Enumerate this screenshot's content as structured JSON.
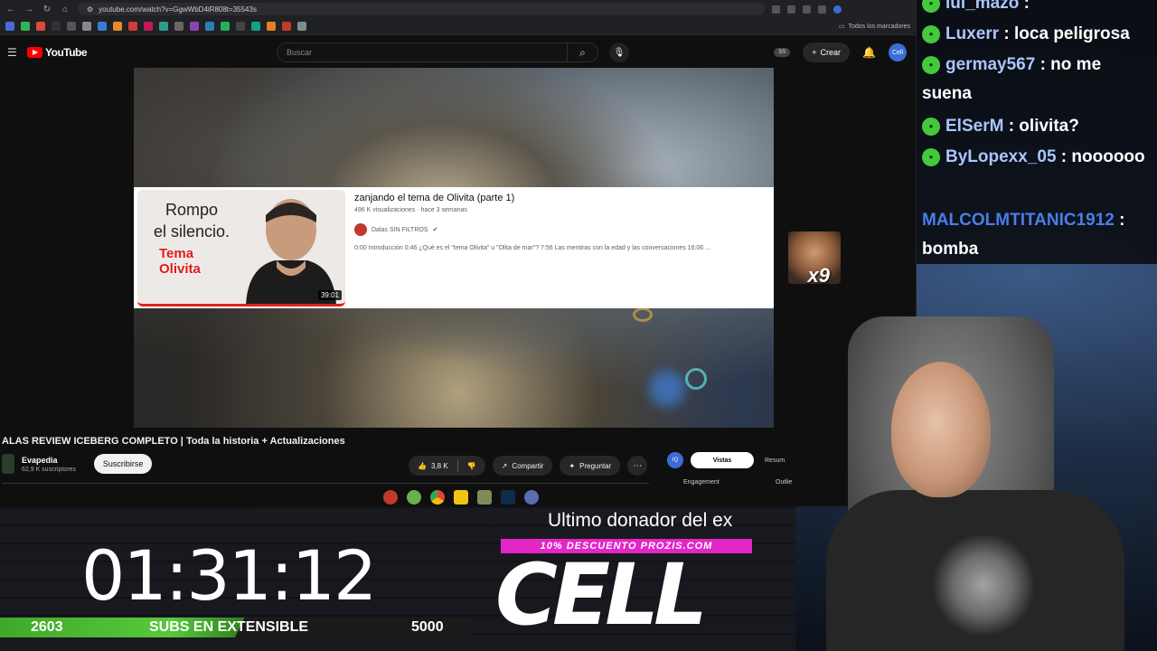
{
  "browser": {
    "url": "youtube.com/watch?v=GgwWbD4iR808t=35543s",
    "bookmarks_folder": "Todos los marcadores"
  },
  "youtube": {
    "logo": "YouTube",
    "search_placeholder": "Buscar",
    "ss_badge": "SS",
    "create_label": "Crear",
    "avatar_text": "Cell"
  },
  "card": {
    "thumb_line1": "Rompo",
    "thumb_line2": "el silencio.",
    "thumb_tema": "Tema\nOlivita",
    "duration": "39:01",
    "title": "zanjando el tema de Olivita (parte 1)",
    "meta": "496 K visualizaciones · hace 3 semanas",
    "channel": "Dalas SIN FILTROS",
    "description": "0:00 Introducción 0:46 ¿Qué es el \"tema Olivita\" u \"Olita de mar\"? 7:56 Las mentiras con la edad y las conversaciones 16:06 ..."
  },
  "video": {
    "title": "ALAS REVIEW ICEBERG COMPLETO | Toda la historia + Actualizaciones",
    "channel": "Evapedia",
    "subscribers": "62,9 K suscriptores",
    "subscribe_label": "Suscribirse",
    "likes": "3,8 K",
    "share_label": "Compartir",
    "ask_label": "Preguntar"
  },
  "sidepanel": {
    "iq": "IQ",
    "tab_active": "Vistas",
    "tab_other": "Resum",
    "label_left": "Engagement",
    "label_right": "Outlie"
  },
  "overlay": {
    "timer": "01:31:12",
    "subs_current": "2603",
    "subs_label": "SUBS EN EXTENSIBLE",
    "subs_goal": "5000",
    "subs_progress": 0.5206,
    "donor": "Ultimo donador del ex",
    "prozis": "10% DESCUENTO PROZIS.COM",
    "brand": "CELL",
    "emote_count": "x9"
  },
  "chat": [
    {
      "user": "lul_mazo",
      "text": ":",
      "color": "#a9c6ff"
    },
    {
      "user": "Luxerr",
      "text": ": loca peligrosa",
      "color": "#a9c6ff"
    },
    {
      "user": "germay567",
      "text": ": no me suena",
      "color": "#a9c6ff"
    },
    {
      "user": "ElSerM",
      "text": ": olivita?",
      "color": "#a9c6ff"
    },
    {
      "user": "ByLopexx_05",
      "text": ": noooooo",
      "color": "#a9c6ff"
    },
    {
      "user": "MALCOLMTITANIC1912",
      "text": ": bomba",
      "color": "#4a7de8"
    }
  ],
  "colors": {
    "youtube_red": "#ff0000",
    "subs_green": "#57c93a",
    "prozis_pink": "#e326c6",
    "chat_badge": "#45c83c"
  }
}
